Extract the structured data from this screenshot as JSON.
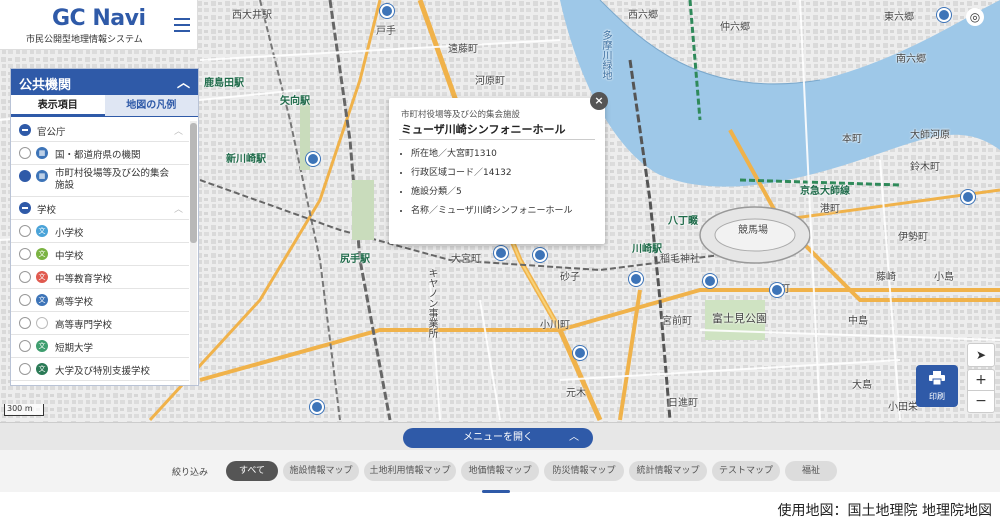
{
  "app": {
    "logo_main": "GC Navi",
    "logo_sub": "市民公開型地理情報システム"
  },
  "panel": {
    "title": "公共機関",
    "tabs": [
      {
        "label": "表示項目",
        "active": true
      },
      {
        "label": "地図の凡例",
        "active": false
      }
    ],
    "rows": [
      {
        "kind": "category",
        "label": "官公庁"
      },
      {
        "kind": "item",
        "label": "国・都道府県の機関",
        "checked": false,
        "icon_color": "#3d74b8",
        "icon": "building-icon"
      },
      {
        "kind": "item",
        "label": "市町村役場等及び公的集会施設",
        "checked": true,
        "icon_color": "#3d74b8",
        "icon": "building-icon"
      },
      {
        "kind": "category",
        "label": "学校"
      },
      {
        "kind": "item",
        "label": "小学校",
        "checked": false,
        "icon_color": "#4aa3d8",
        "icon": "school-icon"
      },
      {
        "kind": "item",
        "label": "中学校",
        "checked": false,
        "icon_color": "#7bb342",
        "icon": "school-icon"
      },
      {
        "kind": "item",
        "label": "中等教育学校",
        "checked": false,
        "icon_color": "#e05a4f",
        "icon": "school-icon"
      },
      {
        "kind": "item",
        "label": "高等学校",
        "checked": false,
        "icon_color": "#3d74b8",
        "icon": "school-icon"
      },
      {
        "kind": "item",
        "label": "高等専門学校",
        "checked": false,
        "icon_color": "#ffffff",
        "icon": "school-icon"
      },
      {
        "kind": "item",
        "label": "短期大学",
        "checked": false,
        "icon_color": "#3f9e6f",
        "icon": "school-icon"
      },
      {
        "kind": "item",
        "label": "大学及び特別支援学校",
        "checked": false,
        "icon_color": "#2a7a56",
        "icon": "school-icon"
      }
    ]
  },
  "popup": {
    "subtitle": "市町村役場等及び公的集会施設",
    "title": "ミューザ川崎シンフォニーホール",
    "fields": [
      "所在地／大宮町1310",
      "行政区域コード／14132",
      "施設分類／5",
      "名称／ミューザ川崎シンフォニーホール"
    ],
    "close": "×"
  },
  "map": {
    "labels": [
      {
        "text": "西大井駅",
        "kind": "normal"
      },
      {
        "text": "戸手",
        "kind": "normal"
      },
      {
        "text": "遠藤町",
        "kind": "normal"
      },
      {
        "text": "河原町",
        "kind": "normal"
      },
      {
        "text": "西六郷",
        "kind": "normal"
      },
      {
        "text": "仲六郷",
        "kind": "normal"
      },
      {
        "text": "東六郷",
        "kind": "normal"
      },
      {
        "text": "南六郷",
        "kind": "normal"
      },
      {
        "text": "多摩川緑地",
        "kind": "river"
      },
      {
        "text": "大師河原",
        "kind": "normal"
      },
      {
        "text": "本町",
        "kind": "normal"
      },
      {
        "text": "鈴木町",
        "kind": "normal"
      },
      {
        "text": "京急大師線",
        "kind": "station"
      },
      {
        "text": "港町",
        "kind": "normal"
      },
      {
        "text": "競馬場",
        "kind": "normal"
      },
      {
        "text": "伊勢町",
        "kind": "normal"
      },
      {
        "text": "八丁畷",
        "kind": "normal"
      },
      {
        "text": "大宮町",
        "kind": "normal"
      },
      {
        "text": "砂子",
        "kind": "normal"
      },
      {
        "text": "稲毛神社",
        "kind": "normal"
      },
      {
        "text": "宮前町",
        "kind": "normal"
      },
      {
        "text": "富士見公園",
        "kind": "normal"
      },
      {
        "text": "川崎駅",
        "kind": "station"
      },
      {
        "text": "尻手駅",
        "kind": "station"
      },
      {
        "text": "小川町",
        "kind": "normal"
      },
      {
        "text": "元木",
        "kind": "normal"
      },
      {
        "text": "日進町",
        "kind": "normal"
      },
      {
        "text": "中島",
        "kind": "normal"
      },
      {
        "text": "大島",
        "kind": "normal"
      },
      {
        "text": "小田栄",
        "kind": "normal"
      },
      {
        "text": "矢向駅",
        "kind": "station"
      },
      {
        "text": "鹿島田駅",
        "kind": "station"
      },
      {
        "text": "新川崎駅",
        "kind": "station"
      },
      {
        "text": "キヤノン事業所",
        "kind": "normal"
      },
      {
        "text": "京町",
        "kind": "normal"
      },
      {
        "text": "藤崎",
        "kind": "normal"
      },
      {
        "text": "小島",
        "kind": "normal"
      }
    ],
    "scale": "300 m"
  },
  "controls": {
    "print_label": "印刷",
    "zoom_in": "+",
    "zoom_out": "−",
    "locate": "➤",
    "compass": "◎"
  },
  "menu": {
    "open_label": "メニューを開く"
  },
  "filter": {
    "label": "絞り込み",
    "chips": [
      {
        "label": "すべて",
        "active": true
      },
      {
        "label": "施設情報マップ",
        "active": false
      },
      {
        "label": "土地利用情報マップ",
        "active": false
      },
      {
        "label": "地価情報マップ",
        "active": false
      },
      {
        "label": "防災情報マップ",
        "active": false
      },
      {
        "label": "統計情報マップ",
        "active": false
      },
      {
        "label": "テストマップ",
        "active": false
      },
      {
        "label": "福祉",
        "active": false
      }
    ]
  },
  "caption": "使用地図：国土地理院 地理院地図"
}
